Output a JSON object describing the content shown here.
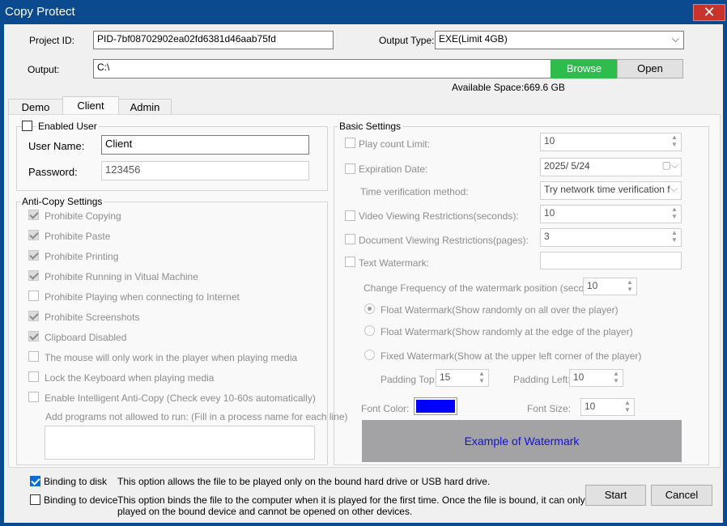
{
  "window": {
    "title": "Copy Protect",
    "close_glyph": "✕"
  },
  "top": {
    "project_id_label": "Project ID:",
    "project_id_value": "PID-7bf08702902ea02fd6381d46aab75fd",
    "output_type_label": "Output Type:",
    "output_type_value": "EXE(Limit 4GB)",
    "output_label": "Output:",
    "output_value": "C:\\",
    "browse_label": "Browse",
    "open_label": "Open",
    "available_space": "Available Space:669.6 GB"
  },
  "tabs": [
    {
      "label": "Demo",
      "active": false
    },
    {
      "label": "Client",
      "active": true
    },
    {
      "label": "Admin",
      "active": false
    }
  ],
  "user": {
    "enabled_label": "Enabled User",
    "enabled_checked": false,
    "username_label": "User Name:",
    "username_value": "Client",
    "password_label": "Password:",
    "password_value": "123456"
  },
  "anticopy": {
    "title": "Anti-Copy Settings",
    "items": [
      {
        "label": "Prohibite Copying",
        "checked": true
      },
      {
        "label": "Prohibite Paste",
        "checked": true
      },
      {
        "label": "Prohibite Printing",
        "checked": true
      },
      {
        "label": "Prohibite Running in Vitual Machine",
        "checked": true
      },
      {
        "label": "Prohibite Playing when connecting to Internet",
        "checked": false
      },
      {
        "label": "Prohibite Screenshots",
        "checked": true
      },
      {
        "label": "Clipboard Disabled",
        "checked": true
      },
      {
        "label": "The mouse will only work in the player when playing media",
        "checked": false
      },
      {
        "label": "Lock the Keyboard when playing media",
        "checked": false
      },
      {
        "label": "Enable Intelligent Anti-Copy (Check evey 10-60s automatically)",
        "checked": false
      }
    ],
    "programs_label": "Add programs not allowed to run: (Fill in a process name for each line)",
    "programs_value": ""
  },
  "basic": {
    "title": "Basic Settings",
    "play_count_label": "Play count Limit:",
    "play_count_value": "10",
    "expiration_label": "Expiration Date:",
    "expiration_value": "2025/  5/24",
    "time_verification_label": "Time verification method:",
    "time_verification_value": "Try network time verification fir:",
    "video_restrict_label": "Video Viewing Restrictions(seconds):",
    "video_restrict_value": "10",
    "doc_restrict_label": "Document Viewing Restrictions(pages):",
    "doc_restrict_value": "3",
    "text_watermark_label": "Text Watermark:",
    "text_watermark_value": "",
    "change_freq_label": "Change Frequency of the watermark position (second):",
    "change_freq_value": "10",
    "radio_float_all": "Float Watermark(Show randomly on all over the player)",
    "radio_float_edge": "Float Watermark(Show randomly at the edge of the player)",
    "radio_fixed": "Fixed Watermark(Show at the upper left corner of the player)",
    "selected_mode": "float_all",
    "padding_top_label": "Padding Top:",
    "padding_top_value": "15",
    "padding_left_label": "Padding Left:",
    "padding_left_value": "10",
    "font_color_label": "Font Color:",
    "font_color_value": "#0000ff",
    "font_size_label": "Font Size:",
    "font_size_value": "10",
    "sample_text": "Example of Watermark"
  },
  "footer": {
    "binding_disk_label": "Binding to disk",
    "binding_disk_checked": true,
    "binding_disk_desc": "This option allows the file to be played only on the bound hard drive or USB hard drive.",
    "binding_device_label": "Binding to device",
    "binding_device_checked": false,
    "binding_device_desc_1": "This option binds the file to the computer when it is played for the first time. Once the file is bound, it can only be",
    "binding_device_desc_2": "played on the bound device and cannot be opened on other devices.",
    "start_label": "Start",
    "cancel_label": "Cancel"
  },
  "colors": {
    "titlebar": "#0b4a8f",
    "browse": "#2ebd4d",
    "close": "#c8332b",
    "check_blue": "#0c6cd0"
  }
}
